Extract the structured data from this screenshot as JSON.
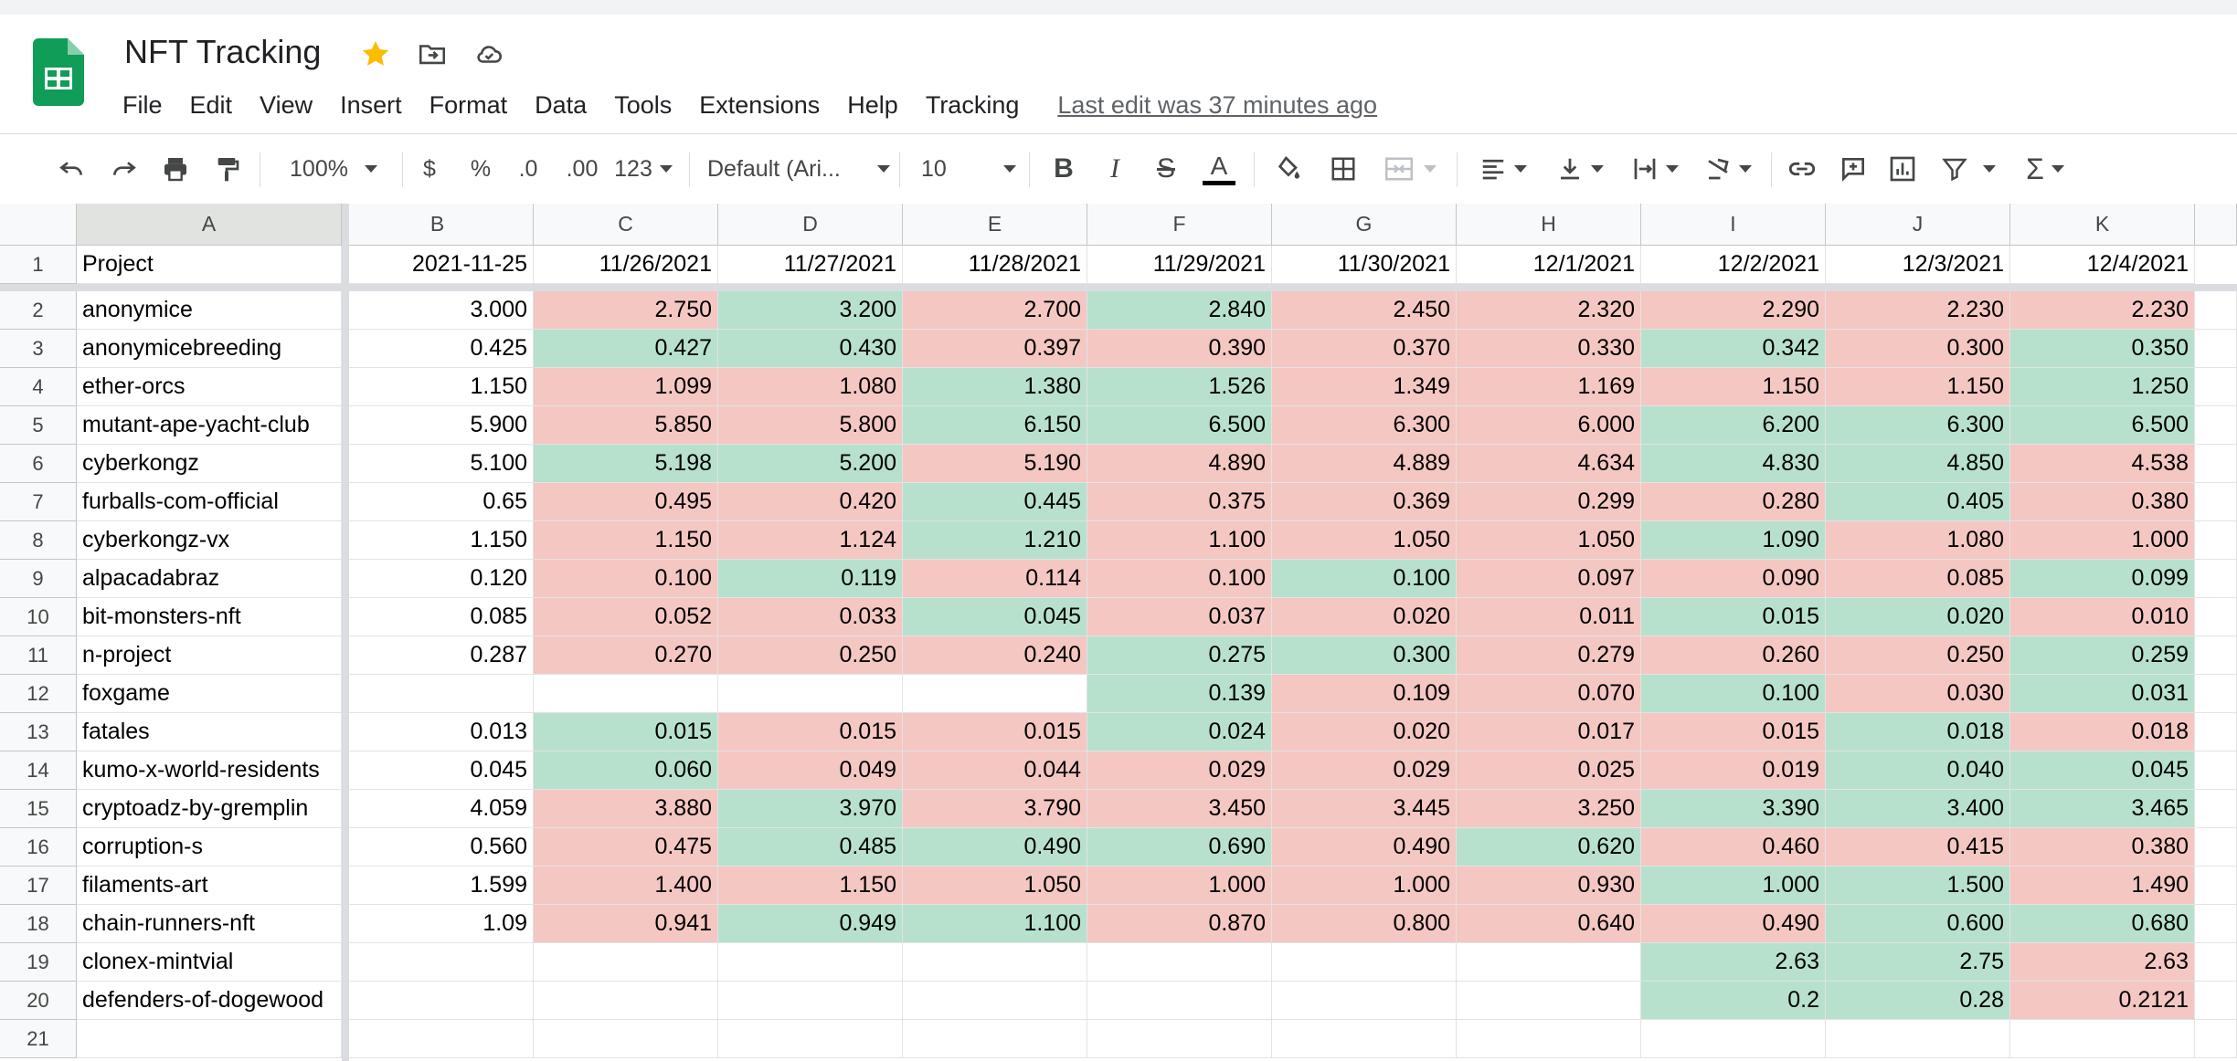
{
  "app": {
    "title": "NFT Tracking",
    "last_edit": "Last edit was 37 minutes ago",
    "menu": [
      "File",
      "Edit",
      "View",
      "Insert",
      "Format",
      "Data",
      "Tools",
      "Extensions",
      "Help",
      "Tracking"
    ]
  },
  "toolbar": {
    "zoom": "100%",
    "currency": "$",
    "percent": "%",
    "dec_decrease": ".0",
    "dec_increase": ".00",
    "more_formats": "123",
    "font": "Default (Ari...",
    "font_size": "10",
    "icons": [
      "undo-icon",
      "redo-icon",
      "print-icon",
      "paint-format-icon",
      "bold-icon",
      "italic-icon",
      "strikethrough-icon",
      "text-color-icon",
      "fill-color-icon",
      "borders-icon",
      "merge-cells-icon",
      "horizontal-align-icon",
      "vertical-align-icon",
      "text-wrap-icon",
      "text-rotation-icon",
      "insert-link-icon",
      "insert-comment-icon",
      "insert-chart-icon",
      "filter-icon",
      "functions-icon"
    ]
  },
  "colors": {
    "red_fill": "#f4c7c3",
    "green_fill": "#b7e1cd",
    "accent_star": "#fbbc04",
    "sheets_green": "#0f9d58"
  },
  "sheet": {
    "columns": [
      "A",
      "B",
      "C",
      "D",
      "E",
      "F",
      "G",
      "H",
      "I",
      "J",
      "K"
    ],
    "headers": [
      "Project",
      "2021-11-25",
      "11/26/2021",
      "11/27/2021",
      "11/28/2021",
      "11/29/2021",
      "11/30/2021",
      "12/1/2021",
      "12/2/2021",
      "12/3/2021",
      "12/4/2021"
    ],
    "rows": [
      [
        "anonymice",
        "3.000",
        "2.750",
        "3.200",
        "2.700",
        "2.840",
        "2.450",
        "2.320",
        "2.290",
        "2.230",
        "2.230"
      ],
      [
        "anonymicebreeding",
        "0.425",
        "0.427",
        "0.430",
        "0.397",
        "0.390",
        "0.370",
        "0.330",
        "0.342",
        "0.300",
        "0.350"
      ],
      [
        "ether-orcs",
        "1.150",
        "1.099",
        "1.080",
        "1.380",
        "1.526",
        "1.349",
        "1.169",
        "1.150",
        "1.150",
        "1.250"
      ],
      [
        "mutant-ape-yacht-club",
        "5.900",
        "5.850",
        "5.800",
        "6.150",
        "6.500",
        "6.300",
        "6.000",
        "6.200",
        "6.300",
        "6.500"
      ],
      [
        "cyberkongz",
        "5.100",
        "5.198",
        "5.200",
        "5.190",
        "4.890",
        "4.889",
        "4.634",
        "4.830",
        "4.850",
        "4.538"
      ],
      [
        "furballs-com-official",
        "0.65",
        "0.495",
        "0.420",
        "0.445",
        "0.375",
        "0.369",
        "0.299",
        "0.280",
        "0.405",
        "0.380"
      ],
      [
        "cyberkongz-vx",
        "1.150",
        "1.150",
        "1.124",
        "1.210",
        "1.100",
        "1.050",
        "1.050",
        "1.090",
        "1.080",
        "1.000"
      ],
      [
        "alpacadabraz",
        "0.120",
        "0.100",
        "0.119",
        "0.114",
        "0.100",
        "0.100",
        "0.097",
        "0.090",
        "0.085",
        "0.099"
      ],
      [
        "bit-monsters-nft",
        "0.085",
        "0.052",
        "0.033",
        "0.045",
        "0.037",
        "0.020",
        "0.011",
        "0.015",
        "0.020",
        "0.010"
      ],
      [
        "n-project",
        "0.287",
        "0.270",
        "0.250",
        "0.240",
        "0.275",
        "0.300",
        "0.279",
        "0.260",
        "0.250",
        "0.259"
      ],
      [
        "foxgame",
        "",
        "",
        "",
        "",
        "0.139",
        "0.109",
        "0.070",
        "0.100",
        "0.030",
        "0.031"
      ],
      [
        "fatales",
        "0.013",
        "0.015",
        "0.015",
        "0.015",
        "0.024",
        "0.020",
        "0.017",
        "0.015",
        "0.018",
        "0.018"
      ],
      [
        "kumo-x-world-residents",
        "0.045",
        "0.060",
        "0.049",
        "0.044",
        "0.029",
        "0.029",
        "0.025",
        "0.019",
        "0.040",
        "0.045"
      ],
      [
        "cryptoadz-by-gremplin",
        "4.059",
        "3.880",
        "3.970",
        "3.790",
        "3.450",
        "3.445",
        "3.250",
        "3.390",
        "3.400",
        "3.465"
      ],
      [
        "corruption-s",
        "0.560",
        "0.475",
        "0.485",
        "0.490",
        "0.690",
        "0.490",
        "0.620",
        "0.460",
        "0.415",
        "0.380"
      ],
      [
        "filaments-art",
        "1.599",
        "1.400",
        "1.150",
        "1.050",
        "1.000",
        "1.000",
        "0.930",
        "1.000",
        "1.500",
        "1.490"
      ],
      [
        "chain-runners-nft",
        "1.09",
        "0.941",
        "0.949",
        "1.100",
        "0.870",
        "0.800",
        "0.640",
        "0.490",
        "0.600",
        "0.680"
      ],
      [
        "clonex-mintvial",
        "",
        "",
        "",
        "",
        "",
        "",
        "",
        "2.63",
        "2.75",
        "2.63"
      ],
      [
        "defenders-of-dogewood",
        "",
        "",
        "",
        "",
        "",
        "",
        "",
        "0.2",
        "0.28",
        "0.2121"
      ],
      [
        "",
        "",
        "",
        "",
        "",
        "",
        "",
        "",
        "",
        "",
        ""
      ]
    ],
    "fills": [
      [
        "",
        "",
        "r",
        "g",
        "r",
        "g",
        "r",
        "r",
        "r",
        "r",
        "r"
      ],
      [
        "",
        "",
        "g",
        "g",
        "r",
        "r",
        "r",
        "r",
        "g",
        "r",
        "g"
      ],
      [
        "",
        "",
        "r",
        "r",
        "g",
        "g",
        "r",
        "r",
        "r",
        "r",
        "g"
      ],
      [
        "",
        "",
        "r",
        "r",
        "g",
        "g",
        "r",
        "r",
        "g",
        "g",
        "g"
      ],
      [
        "",
        "",
        "g",
        "g",
        "r",
        "r",
        "r",
        "r",
        "g",
        "g",
        "r"
      ],
      [
        "",
        "",
        "r",
        "r",
        "g",
        "r",
        "r",
        "r",
        "r",
        "g",
        "r"
      ],
      [
        "",
        "",
        "r",
        "r",
        "g",
        "r",
        "r",
        "r",
        "g",
        "r",
        "r"
      ],
      [
        "",
        "",
        "r",
        "g",
        "r",
        "r",
        "g",
        "r",
        "r",
        "r",
        "g"
      ],
      [
        "",
        "",
        "r",
        "r",
        "g",
        "r",
        "r",
        "r",
        "g",
        "g",
        "r"
      ],
      [
        "",
        "",
        "r",
        "r",
        "r",
        "g",
        "g",
        "r",
        "r",
        "r",
        "g"
      ],
      [
        "",
        "",
        "",
        "",
        "",
        "g",
        "r",
        "r",
        "g",
        "r",
        "g"
      ],
      [
        "",
        "",
        "g",
        "r",
        "r",
        "g",
        "r",
        "r",
        "r",
        "g",
        "r"
      ],
      [
        "",
        "",
        "g",
        "r",
        "r",
        "r",
        "r",
        "r",
        "r",
        "g",
        "g"
      ],
      [
        "",
        "",
        "r",
        "g",
        "r",
        "r",
        "r",
        "r",
        "g",
        "g",
        "g"
      ],
      [
        "",
        "",
        "r",
        "g",
        "g",
        "g",
        "r",
        "g",
        "r",
        "r",
        "r"
      ],
      [
        "",
        "",
        "r",
        "r",
        "r",
        "r",
        "r",
        "r",
        "g",
        "g",
        "r"
      ],
      [
        "",
        "",
        "r",
        "g",
        "g",
        "r",
        "r",
        "r",
        "r",
        "g",
        "g"
      ],
      [
        "",
        "",
        "",
        "",
        "",
        "",
        "",
        "",
        "g",
        "g",
        "r"
      ],
      [
        "",
        "",
        "",
        "",
        "",
        "",
        "",
        "",
        "g",
        "g",
        "r"
      ],
      [
        "",
        "",
        "",
        "",
        "",
        "",
        "",
        "",
        "",
        "",
        ""
      ]
    ]
  }
}
